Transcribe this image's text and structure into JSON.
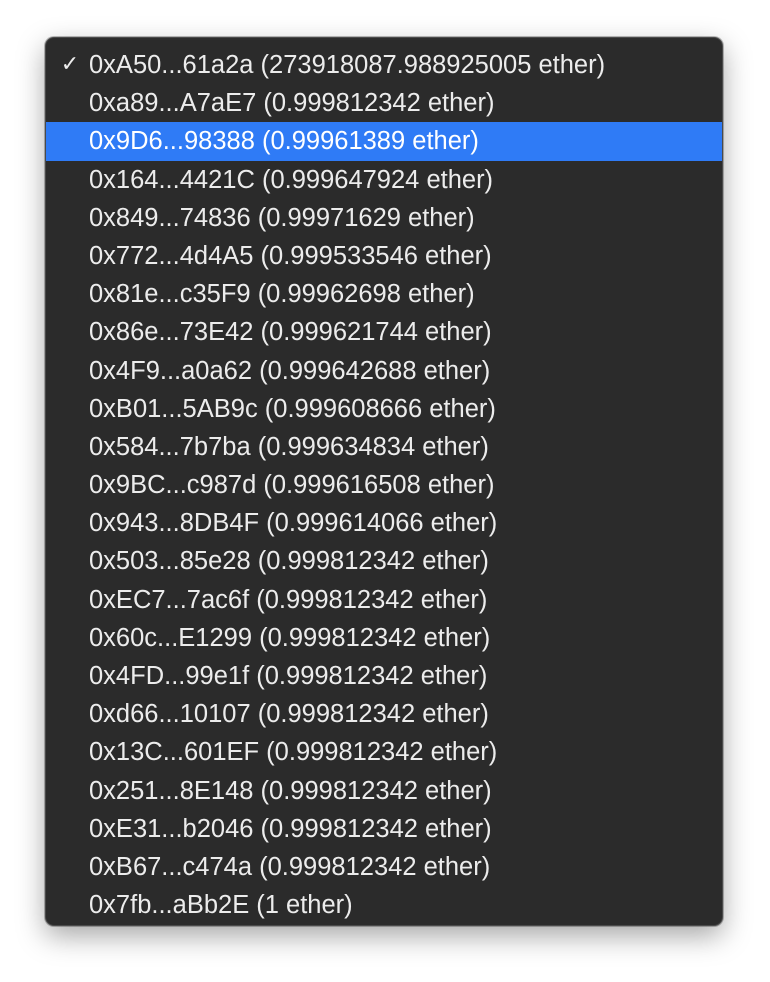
{
  "menu": {
    "checkmark": "✓",
    "selected_index": 0,
    "highlighted_index": 2,
    "highlight_color": "#2f7bf6",
    "background_color": "#2b2b2b",
    "items": [
      {
        "label": "0xA50...61a2a (273918087.988925005 ether)"
      },
      {
        "label": "0xa89...A7aE7 (0.999812342 ether)"
      },
      {
        "label": "0x9D6...98388 (0.99961389 ether)"
      },
      {
        "label": "0x164...4421C (0.999647924 ether)"
      },
      {
        "label": "0x849...74836 (0.99971629 ether)"
      },
      {
        "label": "0x772...4d4A5 (0.999533546 ether)"
      },
      {
        "label": "0x81e...c35F9 (0.99962698 ether)"
      },
      {
        "label": "0x86e...73E42 (0.999621744 ether)"
      },
      {
        "label": "0x4F9...a0a62 (0.999642688 ether)"
      },
      {
        "label": "0xB01...5AB9c (0.999608666 ether)"
      },
      {
        "label": "0x584...7b7ba (0.999634834 ether)"
      },
      {
        "label": "0x9BC...c987d (0.999616508 ether)"
      },
      {
        "label": "0x943...8DB4F (0.999614066 ether)"
      },
      {
        "label": "0x503...85e28 (0.999812342 ether)"
      },
      {
        "label": "0xEC7...7ac6f (0.999812342 ether)"
      },
      {
        "label": "0x60c...E1299 (0.999812342 ether)"
      },
      {
        "label": "0x4FD...99e1f (0.999812342 ether)"
      },
      {
        "label": "0xd66...10107 (0.999812342 ether)"
      },
      {
        "label": "0x13C...601EF (0.999812342 ether)"
      },
      {
        "label": "0x251...8E148 (0.999812342 ether)"
      },
      {
        "label": "0xE31...b2046 (0.999812342 ether)"
      },
      {
        "label": "0xB67...c474a (0.999812342 ether)"
      },
      {
        "label": "0x7fb...aBb2E (1 ether)"
      }
    ]
  }
}
